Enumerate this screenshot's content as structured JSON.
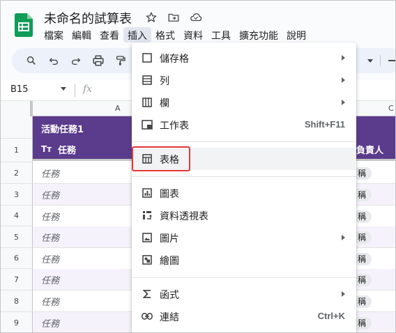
{
  "app": {
    "title": "未命名的試算表",
    "icons": [
      "star-icon",
      "move-to-folder-icon",
      "cloud-status-icon"
    ],
    "brand_color": "#0f9d58"
  },
  "menubar": {
    "items": [
      "檔案",
      "編輯",
      "查看",
      "插入",
      "格式",
      "資料",
      "工具",
      "擴充功能",
      "說明"
    ],
    "active": "插入"
  },
  "toolbar": {
    "icons": [
      "search-icon",
      "undo-icon",
      "redo-icon",
      "print-icon",
      "paint-format-icon",
      "more-dropdown-icon"
    ]
  },
  "formula_bar": {
    "cell_ref": "B15",
    "fx": "fx",
    "value": ""
  },
  "grid": {
    "columns": [
      "A",
      "C"
    ],
    "rows": [
      "1",
      "2",
      "3",
      "4",
      "5",
      "6",
      "7",
      "8",
      "9"
    ],
    "group_title": "活動任務1",
    "header_icon": "Tт",
    "header_first": "任務",
    "header_right": "負責人",
    "task_placeholder": "任務",
    "chip_text": "稱",
    "header_color": "#5b3b8c"
  },
  "insert_menu": {
    "items": [
      {
        "label": "儲存格",
        "icon": "cell-icon",
        "submenu": true
      },
      {
        "label": "列",
        "icon": "row-icon",
        "submenu": true
      },
      {
        "label": "欄",
        "icon": "column-icon",
        "submenu": true
      },
      {
        "label": "工作表",
        "icon": "sheet-icon",
        "shortcut": "Shift+F11"
      },
      {
        "label": "表格",
        "icon": "table-icon",
        "highlighted": true
      },
      {
        "label": "圖表",
        "icon": "chart-icon"
      },
      {
        "label": "資料透視表",
        "icon": "pivot-table-icon"
      },
      {
        "label": "圖片",
        "icon": "image-icon",
        "submenu": true
      },
      {
        "label": "繪圖",
        "icon": "drawing-icon"
      },
      {
        "label": "函式",
        "icon": "sigma-icon",
        "submenu": true
      },
      {
        "label": "連結",
        "icon": "link-icon",
        "shortcut": "Ctrl+K"
      }
    ],
    "highlight_color": "#e53935"
  }
}
